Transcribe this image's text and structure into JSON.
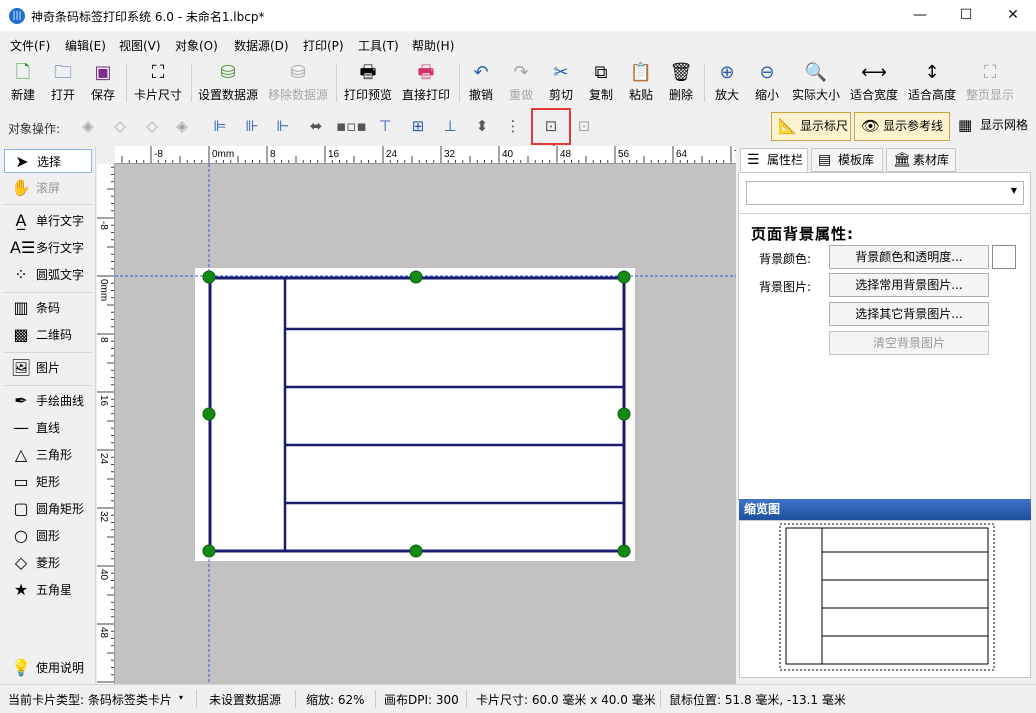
{
  "window": {
    "title": "神奇条码标签打印系统 6.0 - 未命名1.lbcp*",
    "minimize": "—",
    "maximize": "☐",
    "close": "✕"
  },
  "menu": [
    "文件(F)",
    "编辑(E)",
    "视图(V)",
    "对象(O)",
    "数据源(D)",
    "打印(P)",
    "工具(T)",
    "帮助(H)"
  ],
  "toolbar": [
    {
      "label": "新建",
      "icon": "new-file-icon",
      "enabled": true
    },
    {
      "label": "打开",
      "icon": "open-icon",
      "enabled": true
    },
    {
      "label": "保存",
      "icon": "save-icon",
      "enabled": true
    },
    {
      "label": "卡片尺寸",
      "icon": "card-size-icon",
      "enabled": true
    },
    {
      "label": "设置数据源",
      "icon": "database-icon",
      "enabled": true
    },
    {
      "label": "移除数据源",
      "icon": "remove-database-icon",
      "enabled": false
    },
    {
      "label": "打印预览",
      "icon": "print-preview-icon",
      "enabled": true
    },
    {
      "label": "直接打印",
      "icon": "printer-icon",
      "enabled": true
    },
    {
      "label": "撤销",
      "icon": "undo-icon",
      "enabled": true
    },
    {
      "label": "重做",
      "icon": "redo-icon",
      "enabled": false
    },
    {
      "label": "剪切",
      "icon": "scissors-icon",
      "enabled": true
    },
    {
      "label": "复制",
      "icon": "copy-icon",
      "enabled": true
    },
    {
      "label": "粘贴",
      "icon": "paste-icon",
      "enabled": true
    },
    {
      "label": "删除",
      "icon": "trash-icon",
      "enabled": true
    },
    {
      "label": "放大",
      "icon": "zoom-in-icon",
      "enabled": true
    },
    {
      "label": "缩小",
      "icon": "zoom-out-icon",
      "enabled": true
    },
    {
      "label": "实际大小",
      "icon": "actual-size-icon",
      "enabled": true
    },
    {
      "label": "适合宽度",
      "icon": "fit-width-icon",
      "enabled": true
    },
    {
      "label": "适合高度",
      "icon": "fit-height-icon",
      "enabled": true
    },
    {
      "label": "整页显示",
      "icon": "fit-page-icon",
      "enabled": false
    }
  ],
  "object_ops": {
    "label": "对象操作:",
    "toggles": {
      "show_ruler": "显示标尺",
      "show_guides": "显示参考线",
      "show_grid": "显示网格"
    }
  },
  "left_tools": [
    "选择",
    "滚屏",
    "单行文字",
    "多行文字",
    "圆弧文字",
    "条码",
    "二维码",
    "图片",
    "手绘曲线",
    "直线",
    "三角形",
    "矩形",
    "圆角矩形",
    "圆形",
    "菱形",
    "五角星",
    "使用说明"
  ],
  "ruler": {
    "h_labels": [
      "-8",
      "0mm",
      "8",
      "16",
      "24",
      "32",
      "40",
      "48",
      "56",
      "64",
      "72"
    ],
    "v_labels": [
      "-8",
      "0mm",
      "8",
      "16",
      "24",
      "32",
      "40",
      "48"
    ]
  },
  "right_panel": {
    "tabs": [
      "属性栏",
      "模板库",
      "素材库"
    ],
    "section_title": "页面背景属性:",
    "bg_color_label": "背景颜色:",
    "bg_color_button": "背景颜色和透明度...",
    "bg_image_label": "背景图片:",
    "btn_common_bg": "选择常用背景图片...",
    "btn_other_bg": "选择其它背景图片...",
    "btn_clear_bg": "清空背景图片",
    "preview_title": "缩览图"
  },
  "status": {
    "card_type": "当前卡片类型: 条码标签类卡片",
    "datasource": "未设置数据源",
    "zoom": "缩放: 62%",
    "dpi": "画布DPI: 300",
    "card_size": "卡片尺寸: 60.0 毫米 x 40.0 毫米",
    "mouse_pos": "鼠标位置: 51.8 毫米, -13.1 毫米"
  },
  "colors": {
    "table_border": "#1a1a6e",
    "handle": "#138a13",
    "guide": "#3d5bd9",
    "highlight": "#e53935",
    "canvas_bg": "#c2c2c2"
  }
}
